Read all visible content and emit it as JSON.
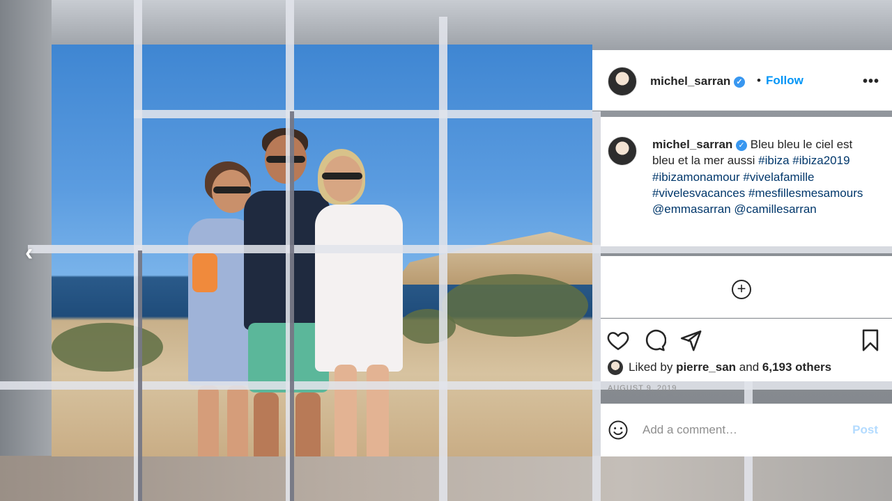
{
  "post": {
    "username": "michel_sarran",
    "verified_glyph": "✓",
    "separator": "•",
    "follow_label": "Follow",
    "more_label": "•••",
    "caption": {
      "username": "michel_sarran",
      "text_plain": "Bleu bleu le ciel est bleu et la mer aussi",
      "hashtags": [
        "#ibiza",
        "#ibiza2019",
        "#ibizamonamour",
        "#vivelafamille",
        "#vivelesvacances",
        "#mesfillesmesamours"
      ],
      "mentions": [
        "@emmasarran",
        "@camillesarran"
      ]
    },
    "add_icon": "plus-circle-icon",
    "likes": {
      "prefix": "Liked by",
      "user": "pierre_san",
      "joiner": "and",
      "count": "6,193 others"
    },
    "date": "AUGUST 9, 2019",
    "comment_placeholder": "Add a comment…",
    "post_label": "Post"
  },
  "nav": {
    "prev_glyph": "‹"
  },
  "colors": {
    "follow_blue": "#0095f6",
    "verified_blue": "#3897f0",
    "post_disabled": "#b3dbff",
    "hashtag": "#00376b"
  }
}
